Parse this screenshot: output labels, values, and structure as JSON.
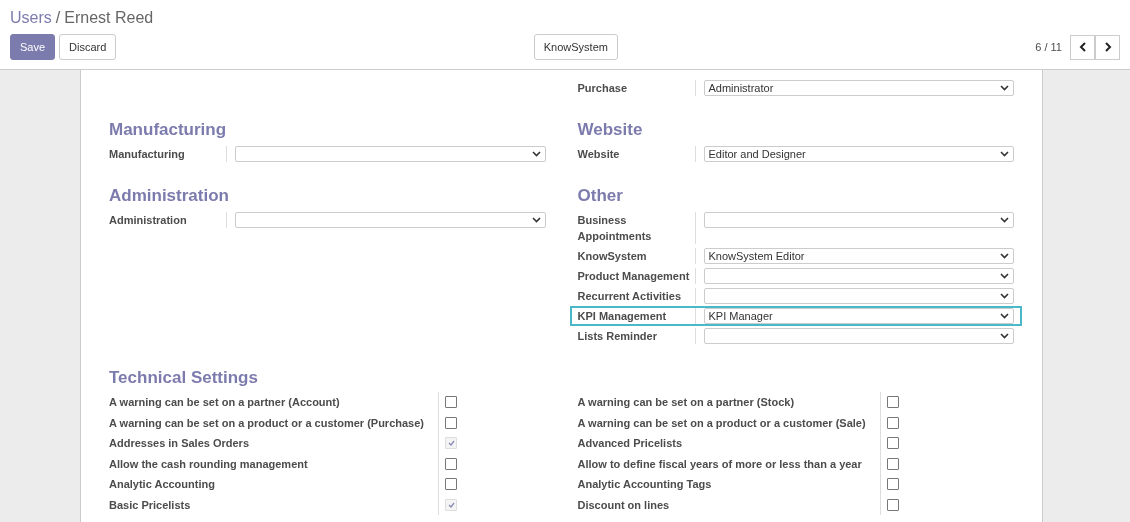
{
  "breadcrumb": {
    "parent": "Users",
    "separator": "/",
    "current": "Ernest Reed"
  },
  "buttons": [
    {
      "label": "Save",
      "kind": "primary"
    },
    {
      "label": "Discard",
      "kind": "secondary"
    }
  ],
  "center_button": "KnowSystem",
  "pager": {
    "counter": "6 / 11"
  },
  "section_rows": [
    {
      "right": {
        "fields": [
          {
            "label": "Purchase",
            "value": "Administrator",
            "highlighted": false
          }
        ]
      }
    },
    {
      "left": {
        "title": "Manufacturing",
        "fields": [
          {
            "label": "Manufacturing",
            "highlighted": false
          }
        ]
      },
      "right": {
        "title": "Website",
        "fields": [
          {
            "label": "Website",
            "value": "Editor and Designer",
            "highlighted": false
          }
        ]
      }
    },
    {
      "left": {
        "title": "Administration",
        "fields": [
          {
            "label": "Administration",
            "highlighted": false
          }
        ]
      },
      "right": {
        "title": "Other",
        "fields": [
          {
            "label": "Business Appointments",
            "highlighted": false
          },
          {
            "label": "KnowSystem",
            "value": "KnowSystem Editor",
            "highlighted": false
          },
          {
            "label": "Product Management",
            "highlighted": false
          },
          {
            "label": "Recurrent Activities",
            "highlighted": false
          },
          {
            "label": "KPI Management",
            "value": "KPI Manager",
            "highlighted": true
          },
          {
            "label": "Lists Reminder",
            "highlighted": false
          }
        ]
      }
    }
  ],
  "technical": {
    "title": "Technical Settings",
    "left": [
      {
        "label": "A warning can be set on a partner (Account)",
        "checked": false
      },
      {
        "label": "A warning can be set on a product or a customer (Purchase)",
        "checked": false
      },
      {
        "label": "Addresses in Sales Orders",
        "checked": true
      },
      {
        "label": "Allow the cash rounding management",
        "checked": false
      },
      {
        "label": "Analytic Accounting",
        "checked": false
      },
      {
        "label": "Basic Pricelists",
        "checked": true
      }
    ],
    "right": [
      {
        "label": "A warning can be set on a partner (Stock)",
        "checked": false
      },
      {
        "label": "A warning can be set on a product or a customer (Sale)",
        "checked": false
      },
      {
        "label": "Advanced Pricelists",
        "checked": false
      },
      {
        "label": "Allow to define fiscal years of more or less than a year",
        "checked": false
      },
      {
        "label": "Analytic Accounting Tags",
        "checked": false
      },
      {
        "label": "Discount on lines",
        "checked": false
      }
    ]
  }
}
